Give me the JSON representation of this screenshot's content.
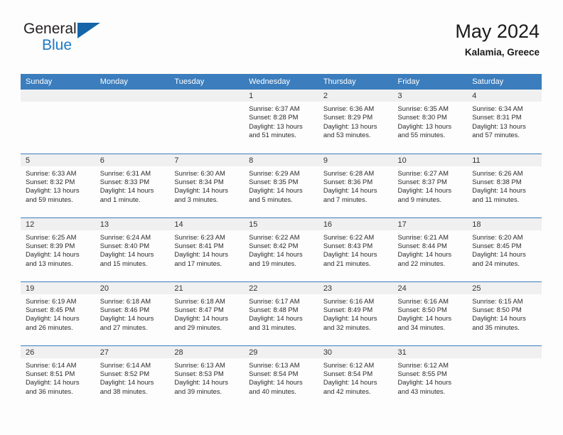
{
  "brand": {
    "line1": "General",
    "line2": "Blue",
    "accent_color": "#1b7ac4",
    "triangle_color": "#1565a8"
  },
  "header": {
    "title": "May 2024",
    "subtitle": "Kalamia, Greece"
  },
  "theme": {
    "header_bg": "#3b7dbd",
    "daynum_bg": "#f0f0f0",
    "page_bg": "#fdfdfd"
  },
  "weekday_headers": [
    "Sunday",
    "Monday",
    "Tuesday",
    "Wednesday",
    "Thursday",
    "Friday",
    "Saturday"
  ],
  "weeks": [
    [
      {
        "day": "",
        "empty": true,
        "sunrise": "",
        "sunset": "",
        "daylight_line1": "",
        "daylight_line2": ""
      },
      {
        "day": "",
        "empty": true,
        "sunrise": "",
        "sunset": "",
        "daylight_line1": "",
        "daylight_line2": ""
      },
      {
        "day": "",
        "empty": true,
        "sunrise": "",
        "sunset": "",
        "daylight_line1": "",
        "daylight_line2": ""
      },
      {
        "day": "1",
        "empty": false,
        "sunrise": "Sunrise: 6:37 AM",
        "sunset": "Sunset: 8:28 PM",
        "daylight_line1": "Daylight: 13 hours",
        "daylight_line2": "and 51 minutes."
      },
      {
        "day": "2",
        "empty": false,
        "sunrise": "Sunrise: 6:36 AM",
        "sunset": "Sunset: 8:29 PM",
        "daylight_line1": "Daylight: 13 hours",
        "daylight_line2": "and 53 minutes."
      },
      {
        "day": "3",
        "empty": false,
        "sunrise": "Sunrise: 6:35 AM",
        "sunset": "Sunset: 8:30 PM",
        "daylight_line1": "Daylight: 13 hours",
        "daylight_line2": "and 55 minutes."
      },
      {
        "day": "4",
        "empty": false,
        "sunrise": "Sunrise: 6:34 AM",
        "sunset": "Sunset: 8:31 PM",
        "daylight_line1": "Daylight: 13 hours",
        "daylight_line2": "and 57 minutes."
      }
    ],
    [
      {
        "day": "5",
        "empty": false,
        "sunrise": "Sunrise: 6:33 AM",
        "sunset": "Sunset: 8:32 PM",
        "daylight_line1": "Daylight: 13 hours",
        "daylight_line2": "and 59 minutes."
      },
      {
        "day": "6",
        "empty": false,
        "sunrise": "Sunrise: 6:31 AM",
        "sunset": "Sunset: 8:33 PM",
        "daylight_line1": "Daylight: 14 hours",
        "daylight_line2": "and 1 minute."
      },
      {
        "day": "7",
        "empty": false,
        "sunrise": "Sunrise: 6:30 AM",
        "sunset": "Sunset: 8:34 PM",
        "daylight_line1": "Daylight: 14 hours",
        "daylight_line2": "and 3 minutes."
      },
      {
        "day": "8",
        "empty": false,
        "sunrise": "Sunrise: 6:29 AM",
        "sunset": "Sunset: 8:35 PM",
        "daylight_line1": "Daylight: 14 hours",
        "daylight_line2": "and 5 minutes."
      },
      {
        "day": "9",
        "empty": false,
        "sunrise": "Sunrise: 6:28 AM",
        "sunset": "Sunset: 8:36 PM",
        "daylight_line1": "Daylight: 14 hours",
        "daylight_line2": "and 7 minutes."
      },
      {
        "day": "10",
        "empty": false,
        "sunrise": "Sunrise: 6:27 AM",
        "sunset": "Sunset: 8:37 PM",
        "daylight_line1": "Daylight: 14 hours",
        "daylight_line2": "and 9 minutes."
      },
      {
        "day": "11",
        "empty": false,
        "sunrise": "Sunrise: 6:26 AM",
        "sunset": "Sunset: 8:38 PM",
        "daylight_line1": "Daylight: 14 hours",
        "daylight_line2": "and 11 minutes."
      }
    ],
    [
      {
        "day": "12",
        "empty": false,
        "sunrise": "Sunrise: 6:25 AM",
        "sunset": "Sunset: 8:39 PM",
        "daylight_line1": "Daylight: 14 hours",
        "daylight_line2": "and 13 minutes."
      },
      {
        "day": "13",
        "empty": false,
        "sunrise": "Sunrise: 6:24 AM",
        "sunset": "Sunset: 8:40 PM",
        "daylight_line1": "Daylight: 14 hours",
        "daylight_line2": "and 15 minutes."
      },
      {
        "day": "14",
        "empty": false,
        "sunrise": "Sunrise: 6:23 AM",
        "sunset": "Sunset: 8:41 PM",
        "daylight_line1": "Daylight: 14 hours",
        "daylight_line2": "and 17 minutes."
      },
      {
        "day": "15",
        "empty": false,
        "sunrise": "Sunrise: 6:22 AM",
        "sunset": "Sunset: 8:42 PM",
        "daylight_line1": "Daylight: 14 hours",
        "daylight_line2": "and 19 minutes."
      },
      {
        "day": "16",
        "empty": false,
        "sunrise": "Sunrise: 6:22 AM",
        "sunset": "Sunset: 8:43 PM",
        "daylight_line1": "Daylight: 14 hours",
        "daylight_line2": "and 21 minutes."
      },
      {
        "day": "17",
        "empty": false,
        "sunrise": "Sunrise: 6:21 AM",
        "sunset": "Sunset: 8:44 PM",
        "daylight_line1": "Daylight: 14 hours",
        "daylight_line2": "and 22 minutes."
      },
      {
        "day": "18",
        "empty": false,
        "sunrise": "Sunrise: 6:20 AM",
        "sunset": "Sunset: 8:45 PM",
        "daylight_line1": "Daylight: 14 hours",
        "daylight_line2": "and 24 minutes."
      }
    ],
    [
      {
        "day": "19",
        "empty": false,
        "sunrise": "Sunrise: 6:19 AM",
        "sunset": "Sunset: 8:45 PM",
        "daylight_line1": "Daylight: 14 hours",
        "daylight_line2": "and 26 minutes."
      },
      {
        "day": "20",
        "empty": false,
        "sunrise": "Sunrise: 6:18 AM",
        "sunset": "Sunset: 8:46 PM",
        "daylight_line1": "Daylight: 14 hours",
        "daylight_line2": "and 27 minutes."
      },
      {
        "day": "21",
        "empty": false,
        "sunrise": "Sunrise: 6:18 AM",
        "sunset": "Sunset: 8:47 PM",
        "daylight_line1": "Daylight: 14 hours",
        "daylight_line2": "and 29 minutes."
      },
      {
        "day": "22",
        "empty": false,
        "sunrise": "Sunrise: 6:17 AM",
        "sunset": "Sunset: 8:48 PM",
        "daylight_line1": "Daylight: 14 hours",
        "daylight_line2": "and 31 minutes."
      },
      {
        "day": "23",
        "empty": false,
        "sunrise": "Sunrise: 6:16 AM",
        "sunset": "Sunset: 8:49 PM",
        "daylight_line1": "Daylight: 14 hours",
        "daylight_line2": "and 32 minutes."
      },
      {
        "day": "24",
        "empty": false,
        "sunrise": "Sunrise: 6:16 AM",
        "sunset": "Sunset: 8:50 PM",
        "daylight_line1": "Daylight: 14 hours",
        "daylight_line2": "and 34 minutes."
      },
      {
        "day": "25",
        "empty": false,
        "sunrise": "Sunrise: 6:15 AM",
        "sunset": "Sunset: 8:50 PM",
        "daylight_line1": "Daylight: 14 hours",
        "daylight_line2": "and 35 minutes."
      }
    ],
    [
      {
        "day": "26",
        "empty": false,
        "sunrise": "Sunrise: 6:14 AM",
        "sunset": "Sunset: 8:51 PM",
        "daylight_line1": "Daylight: 14 hours",
        "daylight_line2": "and 36 minutes."
      },
      {
        "day": "27",
        "empty": false,
        "sunrise": "Sunrise: 6:14 AM",
        "sunset": "Sunset: 8:52 PM",
        "daylight_line1": "Daylight: 14 hours",
        "daylight_line2": "and 38 minutes."
      },
      {
        "day": "28",
        "empty": false,
        "sunrise": "Sunrise: 6:13 AM",
        "sunset": "Sunset: 8:53 PM",
        "daylight_line1": "Daylight: 14 hours",
        "daylight_line2": "and 39 minutes."
      },
      {
        "day": "29",
        "empty": false,
        "sunrise": "Sunrise: 6:13 AM",
        "sunset": "Sunset: 8:54 PM",
        "daylight_line1": "Daylight: 14 hours",
        "daylight_line2": "and 40 minutes."
      },
      {
        "day": "30",
        "empty": false,
        "sunrise": "Sunrise: 6:12 AM",
        "sunset": "Sunset: 8:54 PM",
        "daylight_line1": "Daylight: 14 hours",
        "daylight_line2": "and 42 minutes."
      },
      {
        "day": "31",
        "empty": false,
        "sunrise": "Sunrise: 6:12 AM",
        "sunset": "Sunset: 8:55 PM",
        "daylight_line1": "Daylight: 14 hours",
        "daylight_line2": "and 43 minutes."
      },
      {
        "day": "",
        "empty": true,
        "sunrise": "",
        "sunset": "",
        "daylight_line1": "",
        "daylight_line2": ""
      }
    ]
  ]
}
